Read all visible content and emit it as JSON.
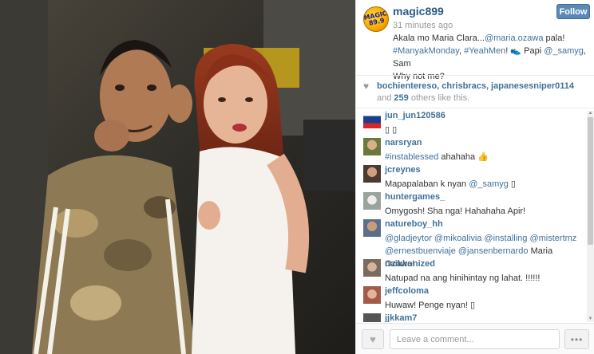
{
  "post": {
    "avatar_text": "MAGIC 89.9",
    "username": "magic899",
    "time_ago": "31 minutes ago",
    "follow_label": "Follow",
    "caption": {
      "line1": "Akala mo Maria Clara...",
      "mention1": "@maria.ozawa",
      "line1_end": " pala!",
      "tag1": "#ManyakMonday",
      "sep1": ", ",
      "tag2": "#YeahMen",
      "line2_mid": "! 👟 Papi ",
      "mention2": "@_samyg",
      "line2_end": ", Sam",
      "line3": "Why not me?"
    }
  },
  "likes": {
    "heart_icon": "heart-icon",
    "users": "bochientereso, chrisbracs, japanesesniper0114",
    "and": " and ",
    "count": "259",
    "suffix": "others like this."
  },
  "comments": [
    {
      "user": "jun_jun120586",
      "text": "▯ ▯",
      "avatar_color": "#1c3e8a"
    },
    {
      "user": "narsryan",
      "tag": "#instablessed",
      "text": " ahahaha 👍",
      "avatar_color": "#6b7a3c"
    },
    {
      "user": "jcreynes",
      "text": "Mapapalaban k nyan ",
      "mention": "@_samyg",
      "text_end": " ▯",
      "avatar_color": "#8c6f5a"
    },
    {
      "user": "huntergames_",
      "text": "Omygosh! Sha nga! Hahahaha Apir!",
      "avatar_color": "#9aa39c"
    },
    {
      "user": "natureboy_hh",
      "mentions": "@gladjeytor @mikoalivia @installing @mistertmz",
      "mentions2": "@ernestbuenviaje @jansenbernardo",
      "text_end": " Maria Ozawa!",
      "avatar_color": "#5c6f8a"
    },
    {
      "user": "naikkonized",
      "text": "Natupad na ang hinihintay ng lahat. !!!!!!",
      "avatar_color": "#7b6a5e"
    },
    {
      "user": "jeffcoloma",
      "text": "Huwaw! Penge nyan! ▯",
      "avatar_color": "#a35a4a"
    },
    {
      "user": "jjkkam7",
      "text": "",
      "avatar_color": "#555555"
    }
  ],
  "footer": {
    "comment_placeholder": "Leave a comment...",
    "more_label": "•••"
  }
}
